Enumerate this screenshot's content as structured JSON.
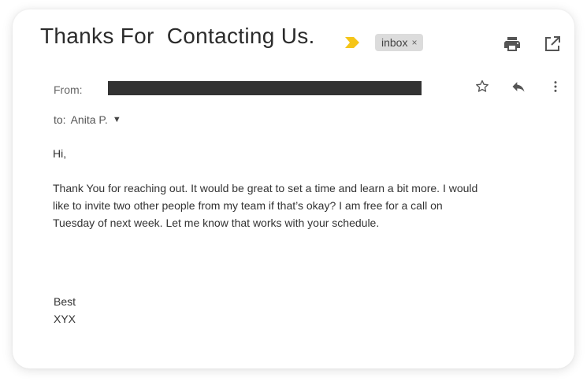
{
  "email": {
    "subject": "Thanks For  Contacting Us.",
    "label": "inbox",
    "label_remove": "×",
    "from_label": "From:",
    "to_label": "to:",
    "to_name": "Anita P.",
    "to_caret": "▼",
    "greeting": "Hi,",
    "body": "Thank You for reaching out. It would be great to set a time and learn a bit more. I would like to invite two other people from my team if that’s okay? I am free for a call on Tuesday of next week. Let me know that works with your schedule.",
    "signoff": "Best",
    "signature": "XYX"
  },
  "icons": {
    "importance": "importance-marker-icon",
    "print": "print-icon",
    "open_new": "open-in-new-window-icon",
    "star": "star-icon",
    "reply": "reply-icon",
    "more": "more-vertical-icon"
  },
  "colors": {
    "importance": "#f5c518",
    "chip_bg": "#dcdcdc",
    "icon": "#555555"
  }
}
